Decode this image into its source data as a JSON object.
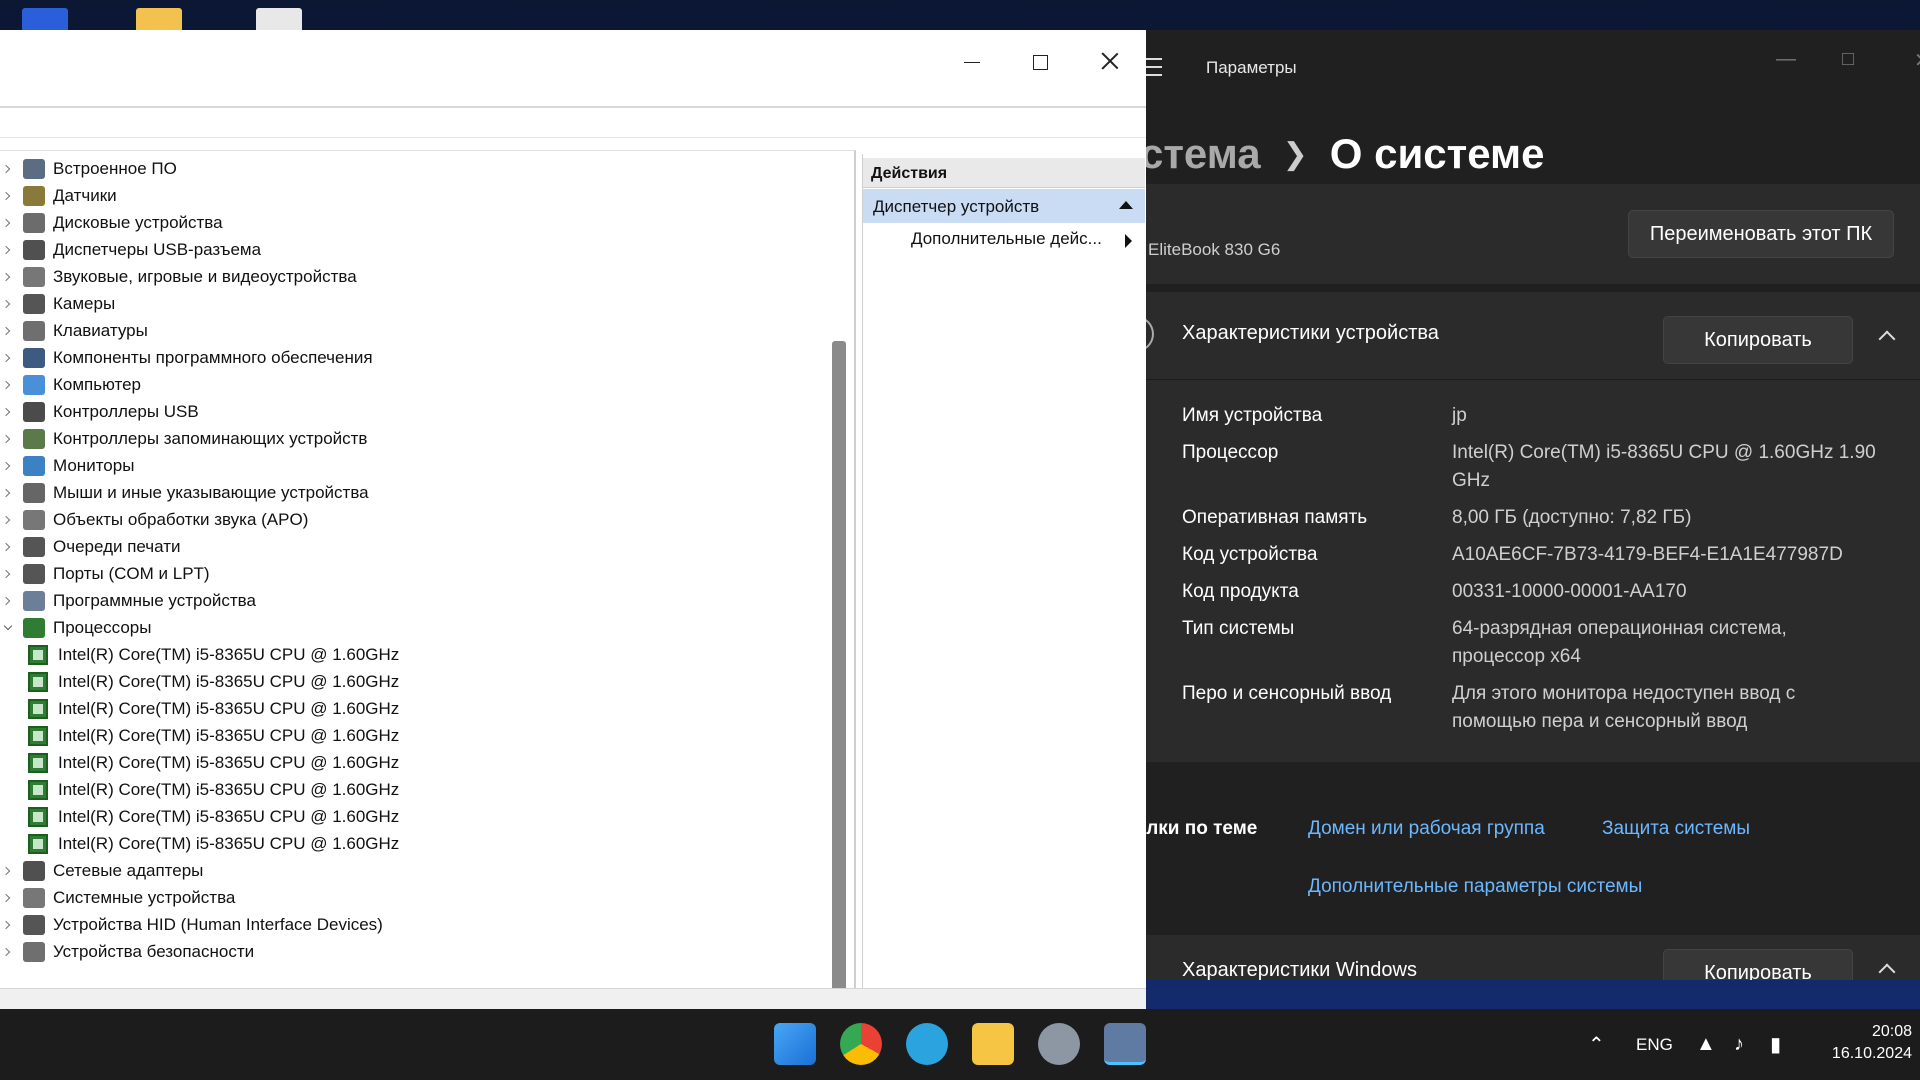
{
  "settings": {
    "app_title": "Параметры",
    "breadcrumb_parent": "стема",
    "breadcrumb_current": "О системе",
    "pc_model": "EliteBook 830 G6",
    "rename_label": "Переименовать этот ПК",
    "device_specs": {
      "title": "Характеристики устройства",
      "copy_label": "Копировать",
      "rows": [
        {
          "key": "Имя устройства",
          "value": "jp"
        },
        {
          "key": "Процессор",
          "value": "Intel(R) Core(TM) i5-8365U CPU @ 1.60GHz   1.90 GHz"
        },
        {
          "key": "Оперативная память",
          "value": "8,00 ГБ (доступно: 7,82 ГБ)"
        },
        {
          "key": "Код устройства",
          "value": "A10AE6CF-7B73-4179-BEF4-E1A1E477987D"
        },
        {
          "key": "Код продукта",
          "value": "00331-10000-00001-AA170"
        },
        {
          "key": "Тип системы",
          "value": "64-разрядная операционная система, процессор x64"
        },
        {
          "key": "Перо и сенсорный ввод",
          "value": "Для этого монитора недоступен ввод с помощью пера и сенсорный ввод"
        }
      ]
    },
    "related": {
      "label": "ылки по теме",
      "link1": "Домен или рабочая группа",
      "link2": "Защита системы",
      "link3": "Дополнительные параметры системы"
    },
    "windows_specs": {
      "title": "Характеристики Windows",
      "copy_label": "Копировать"
    }
  },
  "device_manager": {
    "categories": [
      {
        "label": "Встроенное ПО",
        "icon": "firmware-icon",
        "expanded": false
      },
      {
        "label": "Датчики",
        "icon": "sensor-icon",
        "expanded": false
      },
      {
        "label": "Дисковые устройства",
        "icon": "disk-icon",
        "expanded": false
      },
      {
        "label": "Диспетчеры USB-разъема",
        "icon": "usb-connector-icon",
        "expanded": false
      },
      {
        "label": "Звуковые, игровые и видеоустройства",
        "icon": "speaker-icon",
        "expanded": false
      },
      {
        "label": "Камеры",
        "icon": "camera-icon",
        "expanded": false
      },
      {
        "label": "Клавиатуры",
        "icon": "keyboard-icon",
        "expanded": false
      },
      {
        "label": "Компоненты программного обеспечения",
        "icon": "software-component-icon",
        "expanded": false
      },
      {
        "label": "Компьютер",
        "icon": "computer-icon",
        "expanded": false
      },
      {
        "label": "Контроллеры USB",
        "icon": "usb-icon",
        "expanded": false
      },
      {
        "label": "Контроллеры запоминающих устройств",
        "icon": "storage-controller-icon",
        "expanded": false
      },
      {
        "label": "Мониторы",
        "icon": "monitor-icon",
        "expanded": false
      },
      {
        "label": "Мыши и иные указывающие устройства",
        "icon": "mouse-icon",
        "expanded": false
      },
      {
        "label": "Объекты обработки звука (APO)",
        "icon": "audio-processing-icon",
        "expanded": false
      },
      {
        "label": "Очереди печати",
        "icon": "printer-icon",
        "expanded": false
      },
      {
        "label": "Порты (COM и LPT)",
        "icon": "port-icon",
        "expanded": false
      },
      {
        "label": "Программные устройства",
        "icon": "software-device-icon",
        "expanded": false
      },
      {
        "label": "Процессоры",
        "icon": "processor-icon",
        "expanded": true
      }
    ],
    "processors": [
      "Intel(R) Core(TM) i5-8365U CPU @ 1.60GHz",
      "Intel(R) Core(TM) i5-8365U CPU @ 1.60GHz",
      "Intel(R) Core(TM) i5-8365U CPU @ 1.60GHz",
      "Intel(R) Core(TM) i5-8365U CPU @ 1.60GHz",
      "Intel(R) Core(TM) i5-8365U CPU @ 1.60GHz",
      "Intel(R) Core(TM) i5-8365U CPU @ 1.60GHz",
      "Intel(R) Core(TM) i5-8365U CPU @ 1.60GHz",
      "Intel(R) Core(TM) i5-8365U CPU @ 1.60GHz"
    ],
    "categories_after": [
      {
        "label": "Сетевые адаптеры",
        "icon": "network-adapter-icon"
      },
      {
        "label": "Системные устройства",
        "icon": "system-device-icon"
      },
      {
        "label": "Устройства HID (Human Interface Devices)",
        "icon": "hid-icon"
      },
      {
        "label": "Устройства безопасности",
        "icon": "security-device-icon"
      }
    ],
    "actions": {
      "header": "Действия",
      "selected": "Диспетчер устройств",
      "more": "Дополнительные дейс..."
    }
  },
  "taskbar": {
    "apps": [
      "start-icon",
      "chrome-icon",
      "telegram-icon",
      "file-explorer-icon",
      "settings-icon",
      "device-manager-icon"
    ],
    "lang": "ENG",
    "time": "20:08",
    "date": "16.10.2024"
  },
  "colors": {
    "accent_link": "#6cb8ff",
    "settings_bg": "#202020",
    "card_bg": "#2b2b2b",
    "selection": "#c9dcf4"
  }
}
